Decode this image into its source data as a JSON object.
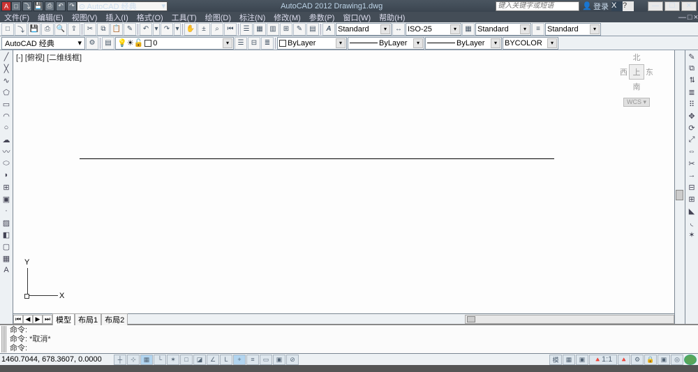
{
  "app": {
    "title": "AutoCAD 2012   Drawing1.dwg"
  },
  "quick_access": [
    "new",
    "open",
    "save",
    "plot",
    "undo",
    "redo"
  ],
  "workspace": {
    "current": "⊙ AutoCAD 经典",
    "vis": "经典"
  },
  "search": {
    "placeholder": "键入关键字或短语"
  },
  "login": {
    "label": "登录"
  },
  "menus": [
    "文件(F)",
    "编辑(E)",
    "视图(V)",
    "插入(I)",
    "格式(O)",
    "工具(T)",
    "绘图(D)",
    "标注(N)",
    "修改(M)",
    "参数(P)",
    "窗口(W)",
    "帮助(H)"
  ],
  "std_toolbar": {
    "groups": [
      "new",
      "open",
      "save",
      "plot",
      "preview",
      "publish",
      "cut",
      "copy",
      "paste",
      "match",
      "undo",
      "redo",
      "pan",
      "zoomrt",
      "zoomwin",
      "zoomprev",
      "props",
      "dc",
      "tp",
      "sheet",
      "markup",
      "calc"
    ],
    "text_style": "Standard",
    "dim_style": "ISO-25",
    "table_style": "Standard",
    "ml_style": "Standard"
  },
  "layer_bar": {
    "workspace": "AutoCAD 经典",
    "layer": "0",
    "bylayer1": "ByLayer",
    "bylayer2": "ByLayer",
    "bylayer3": "ByLayer",
    "color": "BYCOLOR"
  },
  "draw_tools": [
    "line",
    "cline",
    "pline",
    "polygon",
    "rect",
    "arc",
    "circle",
    "revcloud",
    "spline",
    "ellipse",
    "elarc",
    "insert",
    "block",
    "point",
    "hatch",
    "grad",
    "region",
    "table",
    "mtext"
  ],
  "mod_tools": [
    "erase",
    "copy",
    "mirror",
    "offset",
    "array",
    "move",
    "rotate",
    "scale",
    "stretch",
    "trim",
    "extend",
    "break",
    "join",
    "chamfer",
    "fillet",
    "explode"
  ],
  "canvas": {
    "view_label": "[-] [俯视] [二维线框]",
    "ucs": {
      "x": "X",
      "y": "Y"
    },
    "viewcube": {
      "n": "北",
      "s": "南",
      "e": "东",
      "w": "西",
      "top": "上",
      "wcs": "WCS ▾"
    }
  },
  "tabs": {
    "names": [
      "模型",
      "布局1",
      "布局2"
    ],
    "active": 0
  },
  "command": {
    "lines": [
      "命令:",
      "命令: *取消*"
    ],
    "prompt": "命令:"
  },
  "status": {
    "coords": "1460.7044, 678.3607, 0.0000",
    "toggles": [
      "INFER",
      "SNAP",
      "GRID",
      "ORTHO",
      "POLAR",
      "OSNAP",
      "3DOSNAP",
      "OTRACK",
      "DUCS",
      "DYN",
      "LWT",
      "TPY",
      "QP",
      "SC"
    ],
    "right": {
      "model": "模",
      "scale": "1:1"
    }
  }
}
